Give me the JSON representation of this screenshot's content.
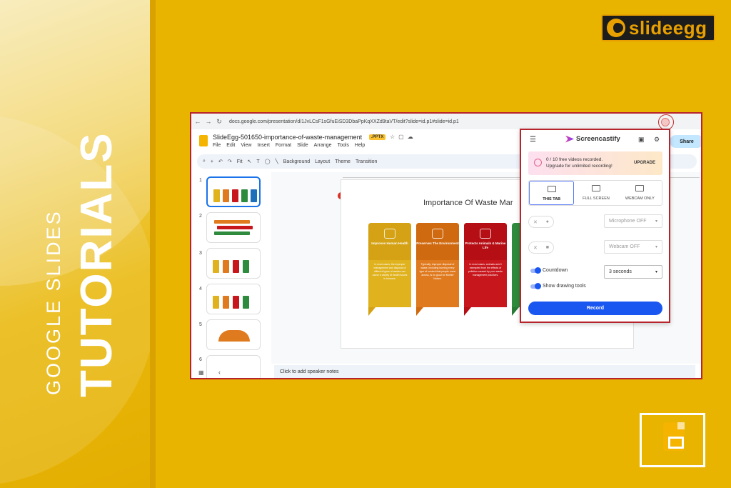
{
  "banner": {
    "line1": "GOOGLE SLIDES",
    "line2": "TUTORIALS"
  },
  "logo": {
    "text": "slideegg"
  },
  "browser": {
    "url": "docs.google.com/presentation/d/1JvLCsF1sGfuEiSD3DbaPpKqXXZd9taVT/edit?slide=id.p1#slide=id.p1"
  },
  "doc": {
    "title": "SlideEgg-501650-importance-of-waste-management",
    "badge": ".PPTX",
    "menus": [
      "File",
      "Edit",
      "View",
      "Insert",
      "Format",
      "Slide",
      "Arrange",
      "Tools",
      "Help"
    ],
    "share_label": "Share"
  },
  "toolbar": {
    "fit_label": "Fit",
    "background_label": "Background",
    "layout_label": "Layout",
    "theme_label": "Theme",
    "transition_label": "Transition"
  },
  "thumbnails": [
    "1",
    "2",
    "3",
    "4",
    "5",
    "6"
  ],
  "slide": {
    "title": "Importance Of Waste Mar",
    "comment_count": "1",
    "cards": [
      {
        "head": "Improves Human Health",
        "body": "In most cases, the improper management and disposal of different types of wastes can cause a variety of health issues in humans.",
        "color": "#E0B21E"
      },
      {
        "head": "Preserves The Environment",
        "body": "Typically, improper disposal of waste, including burning every type of content that people come across, is no good for Mother Nature.",
        "color": "#E07A1F"
      },
      {
        "head": "Protects Animals & Marine Life",
        "body": "In most cases, animals aren't exempted from the effects of pollution caused by poor waste management practices.",
        "color": "#C8161D"
      }
    ]
  },
  "notes_placeholder": "Click to add speaker notes",
  "screencastify": {
    "brand": "Screencastify",
    "banner_line1": "0 / 10 free videos recorded.",
    "banner_line2": "Upgrade for unlimited recording!",
    "upgrade_label": "UPGRADE",
    "tabs": [
      "THIS TAB",
      "FULL SCREEN",
      "WEBCAM ONLY"
    ],
    "microphone": "Microphone OFF",
    "webcam": "Webcam OFF",
    "countdown_label": "Countdown",
    "countdown_value": "3 seconds",
    "drawing_label": "Show drawing tools",
    "record_label": "Record"
  }
}
